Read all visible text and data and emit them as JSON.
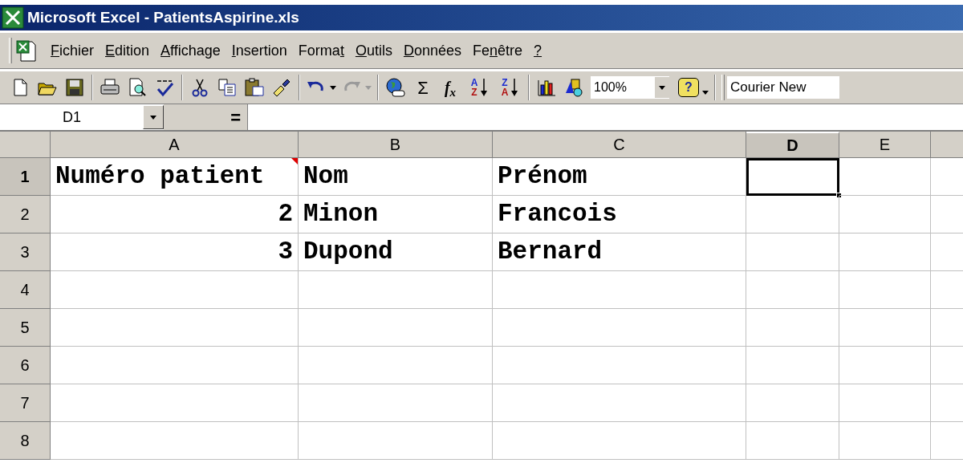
{
  "window": {
    "title": "Microsoft Excel - PatientsAspirine.xls"
  },
  "menu": [
    {
      "key": "F",
      "rest": "ichier"
    },
    {
      "key": "E",
      "rest": "dition"
    },
    {
      "key": "A",
      "rest": "ffichage"
    },
    {
      "key": "I",
      "rest": "nsertion"
    },
    {
      "lead": "Forma",
      "key": "t"
    },
    {
      "key": "O",
      "rest": "utils"
    },
    {
      "key": "D",
      "rest": "onnées"
    },
    {
      "lead": "Fe",
      "key": "n",
      "rest": "être"
    },
    {
      "key": "?"
    }
  ],
  "toolbar": {
    "groups": [
      {
        "items": [
          {
            "kind": "new",
            "disabled": false
          },
          {
            "kind": "open",
            "disabled": false
          },
          {
            "kind": "save",
            "disabled": false
          }
        ]
      },
      {
        "items": [
          {
            "kind": "print",
            "disabled": false
          },
          {
            "kind": "preview",
            "disabled": false
          },
          {
            "kind": "spelling",
            "disabled": false
          }
        ]
      },
      {
        "items": [
          {
            "kind": "cut",
            "disabled": false
          },
          {
            "kind": "copy",
            "disabled": false
          },
          {
            "kind": "paste",
            "disabled": false
          },
          {
            "kind": "brush",
            "disabled": false
          }
        ]
      },
      {
        "items": [
          {
            "kind": "undo",
            "disabled": false
          },
          {
            "kind": "redo",
            "disabled": true
          }
        ]
      },
      {
        "items": [
          {
            "kind": "globe",
            "disabled": false
          },
          {
            "kind": "sum",
            "text": "Σ",
            "disabled": false
          },
          {
            "kind": "function",
            "text": "f$_{x}$",
            "disabled": false
          },
          {
            "kind": "sort",
            "top": "A",
            "bottom": "Z",
            "disabled": false
          },
          {
            "kind": "sort",
            "top": "Z",
            "bottom": "A",
            "disabled": false
          }
        ]
      },
      {
        "items": [
          {
            "kind": "chart",
            "disabled": false
          },
          {
            "kind": "drawing",
            "disabled": false
          },
          {
            "kind": "zoom",
            "text": "100%",
            "disabled": false
          },
          {
            "kind": "help",
            "text": "?",
            "disabled": false
          }
        ]
      },
      {
        "items": [
          {
            "kind": "font",
            "text": "Courier New",
            "disabled": false
          }
        ]
      }
    ]
  },
  "formula_bar": {
    "name_box": "D1",
    "equals": "="
  },
  "columns": [
    {
      "label": "A",
      "selected": false
    },
    {
      "label": "B",
      "selected": false
    },
    {
      "label": "C",
      "selected": false
    },
    {
      "label": "D",
      "selected": true
    },
    {
      "label": "E",
      "selected": false
    }
  ],
  "rows": [
    {
      "label": "1",
      "selected": true,
      "cells": [
        {
          "value": "Numéro patient",
          "kind": "text",
          "comment": true
        },
        {
          "value": "Nom",
          "kind": "text",
          "comment": false
        },
        {
          "value": "Prénom",
          "kind": "text",
          "comment": false
        }
      ]
    },
    {
      "label": "2",
      "selected": false,
      "cells": [
        {
          "value": "2",
          "kind": "number",
          "comment": false
        },
        {
          "value": "Minon",
          "kind": "text",
          "comment": false
        },
        {
          "value": "Francois",
          "kind": "text",
          "comment": false
        }
      ]
    },
    {
      "label": "3",
      "selected": false,
      "cells": [
        {
          "value": "3",
          "kind": "number",
          "comment": false
        },
        {
          "value": "Dupond",
          "kind": "text",
          "comment": false
        },
        {
          "value": "Bernard",
          "kind": "text",
          "comment": false
        }
      ]
    },
    {
      "label": "4",
      "selected": false,
      "cells": []
    },
    {
      "label": "5",
      "selected": false,
      "cells": []
    },
    {
      "label": "6",
      "selected": false,
      "cells": []
    },
    {
      "label": "7",
      "selected": false,
      "cells": []
    },
    {
      "label": "8",
      "selected": false,
      "cells": []
    }
  ]
}
